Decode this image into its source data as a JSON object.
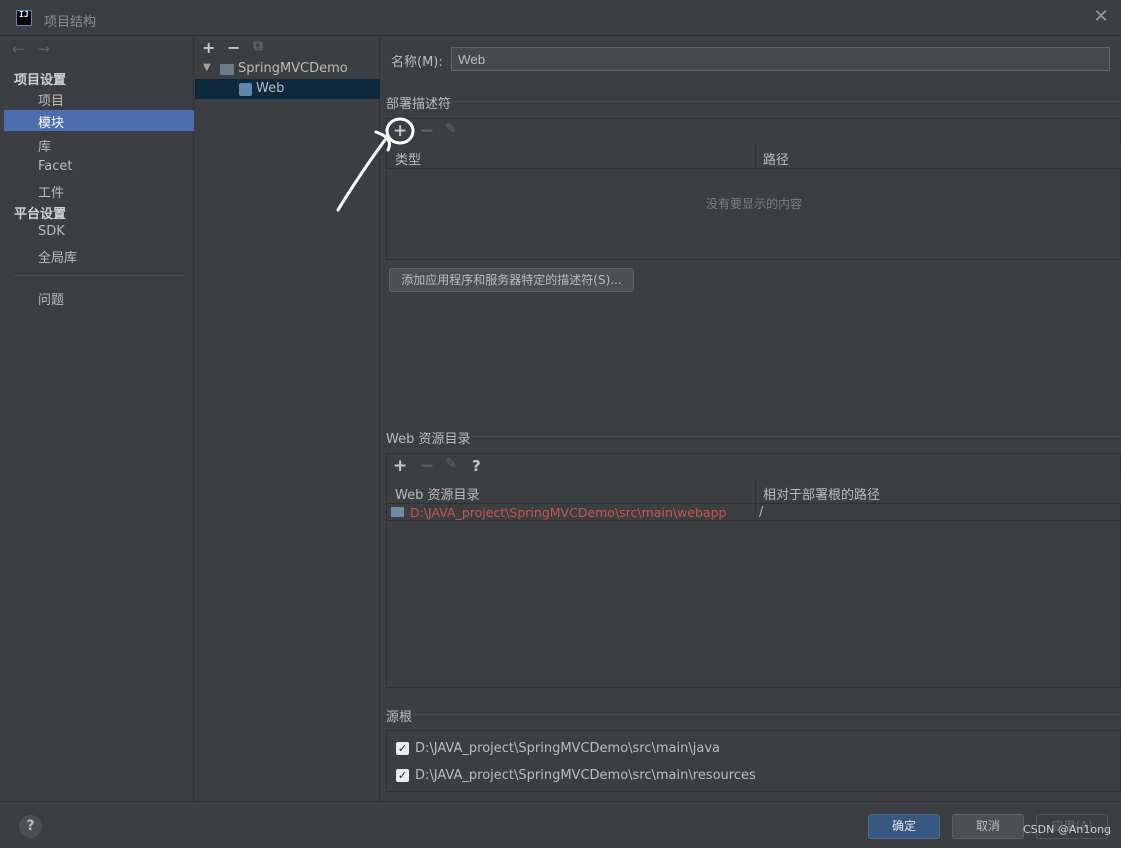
{
  "window": {
    "title": "项目结构"
  },
  "nav": {
    "back_forward": "← →",
    "project_settings_header": "项目设置",
    "project_settings": [
      "项目",
      "模块",
      "库",
      "Facet",
      "工件"
    ],
    "platform_settings_header": "平台设置",
    "platform_settings": [
      "SDK",
      "全局库"
    ],
    "problems": "问题"
  },
  "tree": {
    "add": "+",
    "remove": "−",
    "copy": "⧉",
    "root": "SpringMVCDemo",
    "child": "Web"
  },
  "module": {
    "name_label": "名称(M):",
    "name_value": "Web"
  },
  "descriptors": {
    "section_title": "部署描述符",
    "add": "+",
    "remove": "−",
    "edit": "✎",
    "col_type": "类型",
    "col_path": "路径",
    "empty": "没有要显示的内容",
    "add_specific_button": "添加应用程序和服务器特定的描述符(S)..."
  },
  "web_resources": {
    "section_title": "Web 资源目录",
    "add": "+",
    "remove": "−",
    "edit": "✎",
    "help": "?",
    "col_dir": "Web 资源目录",
    "col_rel": "相对于部署根的路径",
    "rows": [
      {
        "dir": "D:\\JAVA_project\\SpringMVCDemo\\src\\main\\webapp",
        "rel": "/"
      }
    ]
  },
  "source_roots": {
    "section_title": "源根",
    "items": [
      {
        "checked": "✓",
        "path": "D:\\JAVA_project\\SpringMVCDemo\\src\\main\\java"
      },
      {
        "checked": "✓",
        "path": "D:\\JAVA_project\\SpringMVCDemo\\src\\main\\resources"
      }
    ]
  },
  "footer": {
    "help": "?",
    "ok": "确定",
    "cancel": "取消",
    "apply": "应用(A)"
  },
  "watermark": "CSDN @An1ong",
  "colors": {
    "accent": "#4b6eaf",
    "error_path": "#c75450",
    "primary_button": "#365880"
  }
}
